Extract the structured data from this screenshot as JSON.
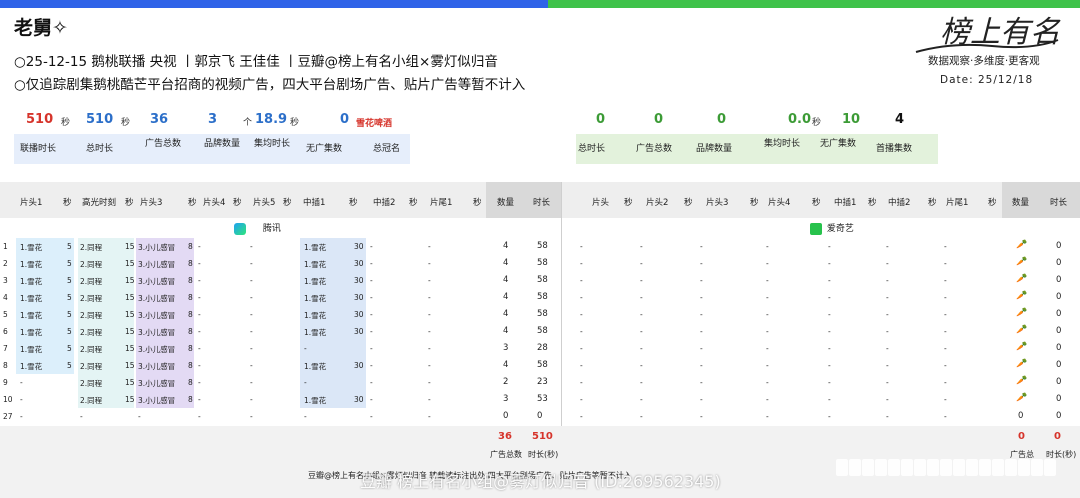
{
  "header": {
    "title": "老舅✧",
    "line1": "○25-12-15  鹅桃联播 央视 丨郭京飞 王佳佳  丨豆瓣@榜上有名小组×雾灯似归音",
    "line2": "○仅追踪剧集鹅桃酷芒平台招商的视频广告，四大平台剧场广告、贴片广告等暂不计入",
    "logo_text": "榜上有名",
    "slogan": "数据观察·多维度·更客观",
    "date": "Date: 25/12/18"
  },
  "stats_left": {
    "values": [
      {
        "value": "510",
        "unit": "秒",
        "label": "联播时长",
        "color": "#d6342b"
      },
      {
        "value": "510",
        "unit": "秒",
        "label": "总时长",
        "color": "#2c6fc9"
      },
      {
        "value": "36",
        "unit": "",
        "label": "广告总数",
        "color": "#2c6fc9"
      },
      {
        "value": "3",
        "unit": "个",
        "label": "品牌数量",
        "color": "#2c6fc9"
      },
      {
        "value": "18.9",
        "unit": "秒",
        "label": "集均时长",
        "color": "#2c6fc9"
      },
      {
        "value": "0",
        "unit": "",
        "label": "无广集数",
        "color": "#2c6fc9"
      }
    ],
    "title_sponsor": "雪花啤酒",
    "title_sponsor_label": "总冠名"
  },
  "stats_right": {
    "values": [
      {
        "value": "0",
        "label": "总时长"
      },
      {
        "value": "0",
        "label": "广告总数"
      },
      {
        "value": "0",
        "label": "品牌数量"
      },
      {
        "value": "0.0",
        "unit": "秒",
        "label": "集均时长"
      },
      {
        "value": "10",
        "label": "无广集数"
      },
      {
        "value": "4",
        "label": "首播集数"
      }
    ]
  },
  "table": {
    "headers_left": [
      "片头1",
      "秒",
      "高光时刻",
      "秒",
      "片头3",
      "秒",
      "片头4",
      "秒",
      "片头5",
      "秒",
      "中插1",
      "秒",
      "中插2",
      "秒",
      "片尾1",
      "秒",
      "数量",
      "时长"
    ],
    "headers_right": [
      "片头",
      "秒",
      "片头2",
      "秒",
      "片头3",
      "秒",
      "片头4",
      "秒",
      "中插1",
      "秒",
      "中插2",
      "秒",
      "片尾1",
      "秒",
      "数量",
      "时长"
    ],
    "platform_left": "腾讯",
    "platform_right": "爱奇艺",
    "rows": [
      {
        "ep": "1",
        "p1": "1.雪花",
        "s1": "5",
        "p2": "2.同程",
        "s2": "15",
        "p3": "3.小儿感冒",
        "s3": "8",
        "m1": "1.雪花",
        "ms1": "30",
        "count": "4",
        "dur": "58"
      },
      {
        "ep": "2",
        "p1": "1.雪花",
        "s1": "5",
        "p2": "2.同程",
        "s2": "15",
        "p3": "3.小儿感冒",
        "s3": "8",
        "m1": "1.雪花",
        "ms1": "30",
        "count": "4",
        "dur": "58"
      },
      {
        "ep": "3",
        "p1": "1.雪花",
        "s1": "5",
        "p2": "2.同程",
        "s2": "15",
        "p3": "3.小儿感冒",
        "s3": "8",
        "m1": "1.雪花",
        "ms1": "30",
        "count": "4",
        "dur": "58"
      },
      {
        "ep": "4",
        "p1": "1.雪花",
        "s1": "5",
        "p2": "2.同程",
        "s2": "15",
        "p3": "3.小儿感冒",
        "s3": "8",
        "m1": "1.雪花",
        "ms1": "30",
        "count": "4",
        "dur": "58"
      },
      {
        "ep": "5",
        "p1": "1.雪花",
        "s1": "5",
        "p2": "2.同程",
        "s2": "15",
        "p3": "3.小儿感冒",
        "s3": "8",
        "m1": "1.雪花",
        "ms1": "30",
        "count": "4",
        "dur": "58"
      },
      {
        "ep": "6",
        "p1": "1.雪花",
        "s1": "5",
        "p2": "2.同程",
        "s2": "15",
        "p3": "3.小儿感冒",
        "s3": "8",
        "m1": "1.雪花",
        "ms1": "30",
        "count": "4",
        "dur": "58"
      },
      {
        "ep": "7",
        "p1": "1.雪花",
        "s1": "5",
        "p2": "2.同程",
        "s2": "15",
        "p3": "3.小儿感冒",
        "s3": "8",
        "m1": "-",
        "ms1": "",
        "count": "3",
        "dur": "28"
      },
      {
        "ep": "8",
        "p1": "1.雪花",
        "s1": "5",
        "p2": "2.同程",
        "s2": "15",
        "p3": "3.小儿感冒",
        "s3": "8",
        "m1": "1.雪花",
        "ms1": "30",
        "count": "4",
        "dur": "58"
      },
      {
        "ep": "9",
        "p1": "-",
        "s1": "",
        "p2": "2.同程",
        "s2": "15",
        "p3": "3.小儿感冒",
        "s3": "8",
        "m1": "-",
        "ms1": "",
        "count": "2",
        "dur": "23"
      },
      {
        "ep": "10",
        "p1": "-",
        "s1": "",
        "p2": "2.同程",
        "s2": "15",
        "p3": "3.小儿感冒",
        "s3": "8",
        "m1": "1.雪花",
        "ms1": "30",
        "count": "3",
        "dur": "53"
      },
      {
        "ep": "27",
        "p1": "-",
        "s1": "",
        "p2": "-",
        "s2": "",
        "p3": "-",
        "s3": "",
        "m1": "-",
        "ms1": "",
        "count": "0",
        "dur": "0"
      }
    ],
    "right_dur": [
      "0",
      "0",
      "0",
      "0",
      "0",
      "0",
      "0",
      "0",
      "0",
      "0",
      "0"
    ],
    "footer_left": {
      "count": "36",
      "dur": "510",
      "count_label": "广告总数",
      "dur_label": "时长(秒)"
    },
    "footer_right": {
      "count": "0",
      "dur": "0",
      "count_label": "广告总",
      "dur_label": "时长(秒)"
    },
    "footer_note": "豆瓣@榜上有名小组×雾灯似归音 转载请标注出处  四大平台剧场广告、贴片广告等暂不计入",
    "watermark": "豆瓣 榜上有名小组@雾灯似归音 (ID:269562345)"
  },
  "colors": {
    "red": "#d6342b",
    "blue": "#2c6fc9",
    "green": "#3c9b36",
    "top_blue": "#2f63e8",
    "top_green": "#3fc24a"
  }
}
